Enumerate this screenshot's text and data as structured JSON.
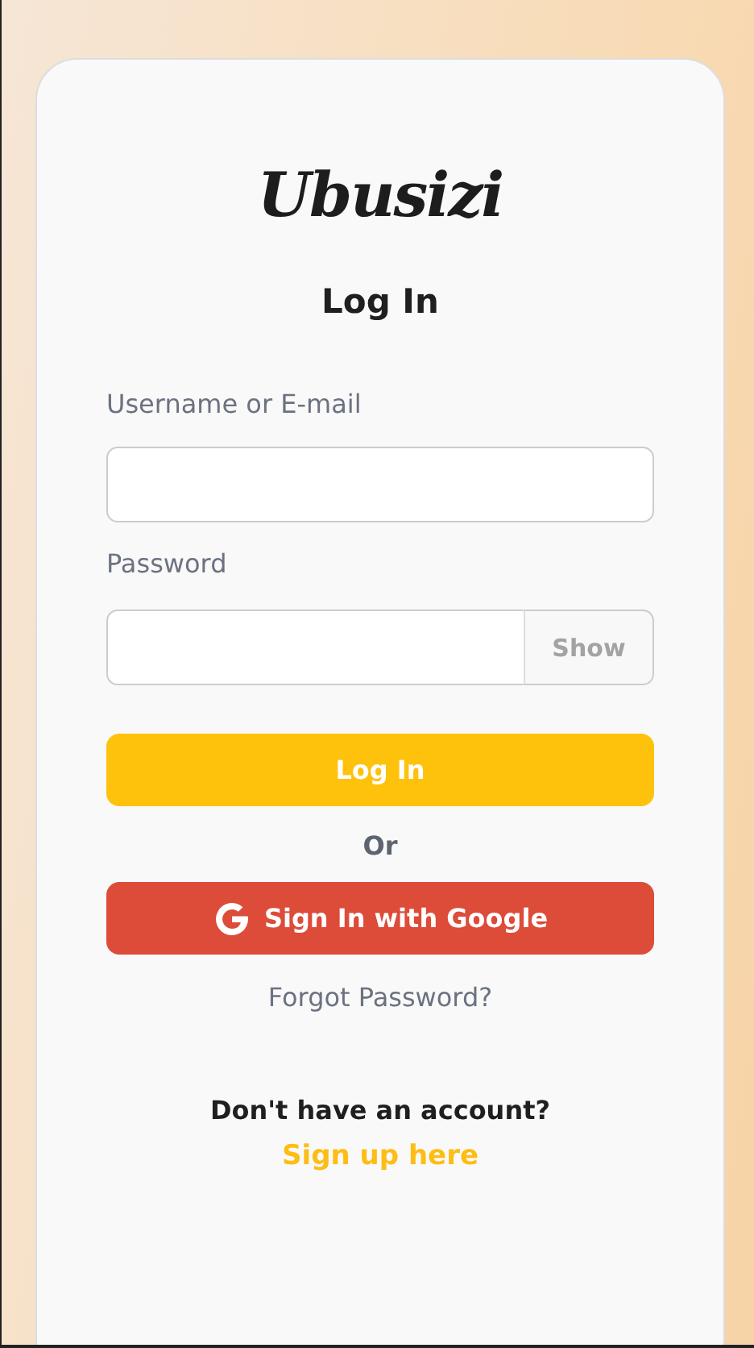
{
  "logo": "Ubusizi",
  "title": "Log In",
  "fields": [
    {
      "label": "Username or E-mail",
      "kind": "text"
    },
    {
      "label": "Password",
      "kind": "password",
      "toggle": "Show"
    }
  ],
  "login_button": "Log In",
  "separator": "Or",
  "google_button": "Sign In with Google",
  "forgot_link": "Forgot Password?",
  "signup_prompt": "Don't have an account?",
  "signup_link": "Sign up here"
}
